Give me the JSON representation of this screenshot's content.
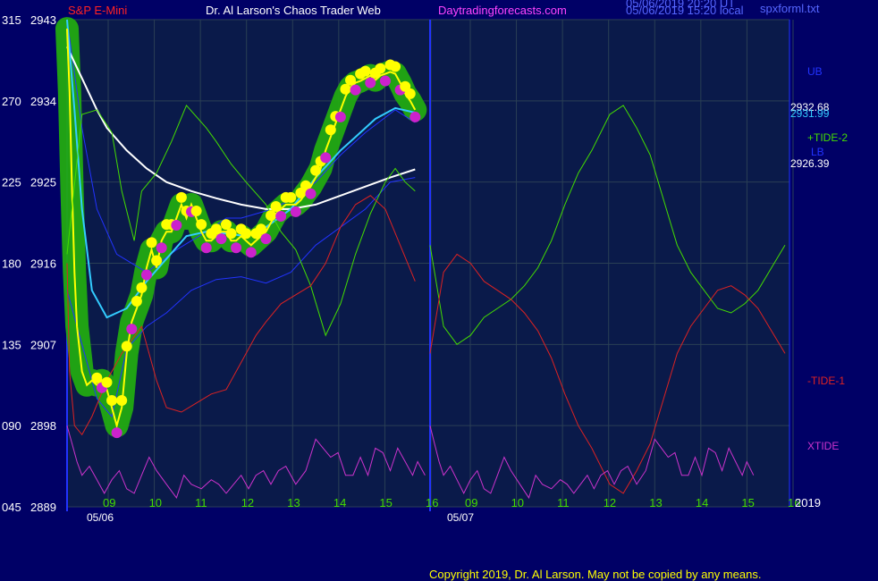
{
  "header": {
    "symbol": "S&P E-Mini",
    "author": "Dr. Al Larson's Chaos Trader Web",
    "site": "Daytradingforecasts.com",
    "stamp_line1": "05/06/2019 20:20 UT",
    "stamp_line2": "05/06/2019 15:20 local",
    "filename": "spxforml.txt"
  },
  "footer": {
    "copyright": "Copyright 2019, Dr. Al Larson. May not be copied by any means."
  },
  "chart_data": {
    "type": "line",
    "title": "S&P E-Mini",
    "ylim": [
      2889,
      2943
    ],
    "y_ticks": [
      {
        "left": "315",
        "right": "2943",
        "value": 2943
      },
      {
        "left": "270",
        "right": "2934",
        "value": 2934
      },
      {
        "left": "225",
        "right": "2925",
        "value": 2925
      },
      {
        "left": "180",
        "right": "2916",
        "value": 2916
      },
      {
        "left": "135",
        "right": "2907",
        "value": 2907
      },
      {
        "left": "090",
        "right": "2898",
        "value": 2898
      },
      {
        "left": "045",
        "right": "2889",
        "value": 2889
      }
    ],
    "x_hours": [
      "09",
      "10",
      "11",
      "12",
      "13",
      "14",
      "15",
      "16",
      "09",
      "10",
      "11",
      "12",
      "13",
      "14",
      "15",
      "16"
    ],
    "x_dates": [
      "05/06",
      "05/07"
    ],
    "year": "2019",
    "right_labels": {
      "ub": "UB",
      "v1": "2932.68",
      "v2": "2931.99",
      "tide2": "+TIDE-2",
      "lb": "LB",
      "v3": "2926.39",
      "tide1": "-TIDE-1",
      "xtide": "XTIDE"
    },
    "series": [
      {
        "name": "UB",
        "color": "#2233ff",
        "x": [
          0,
          0.3,
          0.6,
          1,
          1.6,
          2.2,
          2.8,
          3.2,
          3.5,
          4,
          4.5,
          5,
          5.5,
          6,
          6.6,
          7
        ],
        "y": [
          2943,
          2931,
          2922,
          2917,
          2915,
          2917.5,
          2919.5,
          2921,
          2921,
          2921.8,
          2923,
          2925,
          2928,
          2930.5,
          2933,
          2931.6
        ]
      },
      {
        "name": "LB",
        "color": "#2233ff",
        "x": [
          0,
          0.3,
          0.6,
          0.9,
          1.2,
          1.6,
          2,
          2.5,
          3,
          3.5,
          4,
          4.5,
          5,
          5.5,
          6,
          6.5,
          7
        ],
        "y": [
          2913,
          2907,
          2901,
          2899,
          2906.5,
          2909,
          2910.5,
          2913,
          2914.2,
          2914.5,
          2913.8,
          2915,
          2918,
          2920,
          2922,
          2925,
          2925.5
        ]
      },
      {
        "name": "slow average",
        "color": "#ffffff",
        "x": [
          0,
          0.3,
          0.6,
          0.8,
          1.2,
          1.6,
          2,
          2.5,
          3,
          3.5,
          4,
          4.5,
          5,
          5.5,
          6,
          6.5,
          7
        ],
        "y": [
          2940,
          2936.5,
          2933,
          2931,
          2928.5,
          2926.5,
          2925,
          2924,
          2923.2,
          2922.5,
          2922,
          2922,
          2922.5,
          2923.5,
          2924.5,
          2925.5,
          2926.4
        ]
      },
      {
        "name": "fast average",
        "color": "#33ccff",
        "x": [
          0,
          0.15,
          0.3,
          0.5,
          0.8,
          1.2,
          1.6,
          2,
          2.4,
          2.8,
          3.2,
          3.6,
          4,
          4.5,
          5,
          5.5,
          5.8,
          6.2,
          6.6,
          7
        ],
        "y": [
          2943,
          2933,
          2922,
          2913,
          2910,
          2911,
          2914,
          2916.5,
          2919,
          2919.5,
          2919.3,
          2919,
          2920,
          2922,
          2925.5,
          2928.5,
          2930,
          2932,
          2933.2,
          2932.7
        ]
      },
      {
        "name": "price",
        "color": "#ffff00",
        "x": [
          0,
          0.05,
          0.1,
          0.15,
          0.2,
          0.3,
          0.4,
          0.5,
          0.6,
          0.7,
          0.8,
          0.9,
          1,
          1.1,
          1.2,
          1.3,
          1.4,
          1.5,
          1.6,
          1.7,
          1.8,
          1.9,
          2,
          2.1,
          2.2,
          2.3,
          2.4,
          2.5,
          2.6,
          2.7,
          2.8,
          2.9,
          3,
          3.1,
          3.2,
          3.3,
          3.4,
          3.5,
          3.6,
          3.7,
          3.8,
          3.9,
          4,
          4.1,
          4.2,
          4.3,
          4.4,
          4.5,
          4.6,
          4.7,
          4.8,
          4.9,
          5,
          5.1,
          5.2,
          5.3,
          5.4,
          5.5,
          5.6,
          5.7,
          5.8,
          5.9,
          6,
          6.1,
          6.2,
          6.3,
          6.4,
          6.5,
          6.6,
          6.7,
          6.8,
          6.9,
          7
        ],
        "y": [
          2942,
          2935,
          2924,
          2915,
          2909,
          2904,
          2902.5,
          2903,
          2902.5,
          2903,
          2902,
          2900,
          2898,
          2900,
          2906,
          2909.5,
          2911,
          2912.5,
          2915.5,
          2917.5,
          2915.5,
          2918.5,
          2919.5,
          2919.5,
          2921,
          2922.5,
          2921,
          2922.5,
          2921,
          2919.5,
          2918.5,
          2918.5,
          2919,
          2919.5,
          2919.5,
          2918.5,
          2918.5,
          2919,
          2918.5,
          2918,
          2918.5,
          2919,
          2919.5,
          2920.5,
          2921.5,
          2922,
          2922.5,
          2922.5,
          2922.5,
          2923,
          2923.8,
          2924.5,
          2925.5,
          2926.5,
          2928.5,
          2930,
          2931.5,
          2933,
          2934.5,
          2935.5,
          2936,
          2936.2,
          2936.5,
          2936.8,
          2936.3,
          2936.8,
          2937,
          2937.2,
          2937,
          2936,
          2934.8,
          2934,
          2933
        ]
      },
      {
        "name": "+TIDE-2",
        "color": "#44dd00",
        "x": [
          0,
          0.3,
          0.6,
          0.9,
          1.1,
          1.35,
          1.5,
          1.8,
          2.1,
          2.4,
          2.8,
          3,
          3.3,
          3.6,
          4,
          4.3,
          4.6,
          4.9,
          5.2,
          5.5,
          5.8,
          6.1,
          6.4,
          6.6,
          6.8,
          7
        ],
        "y": [
          2917,
          2932.5,
          2933,
          2930.5,
          2924,
          2918.5,
          2924,
          2926,
          2929.5,
          2933.5,
          2931,
          2929.5,
          2927,
          2925,
          2922.5,
          2919.5,
          2917.5,
          2913.5,
          2908,
          2911.5,
          2917,
          2921.5,
          2925,
          2926.5,
          2925,
          2924
        ]
      },
      {
        "name": "-TIDE-1",
        "color": "#dd2222",
        "x": [
          0,
          0.05,
          0.15,
          0.3,
          0.5,
          0.8,
          1.1,
          1.5,
          1.8,
          2,
          2.3,
          2.6,
          2.9,
          3.2,
          3.5,
          3.8,
          4,
          4.3,
          4.6,
          4.9,
          5.2,
          5.5,
          5.8,
          6.1,
          6.4,
          6.7,
          7
        ],
        "y": [
          2916,
          2904,
          2898,
          2897,
          2899,
          2903,
          2906,
          2909,
          2903,
          2900,
          2899.5,
          2900.5,
          2901.5,
          2902,
          2905,
          2908,
          2909.5,
          2911.5,
          2912.5,
          2913.5,
          2916,
          2920,
          2922.5,
          2923.5,
          2922,
          2918,
          2914
        ]
      },
      {
        "name": "XTIDE",
        "color": "#cc33cc",
        "x": [
          0,
          0.1,
          0.2,
          0.3,
          0.45,
          0.6,
          0.75,
          0.9,
          1.05,
          1.2,
          1.35,
          1.5,
          1.65,
          1.8,
          2,
          2.2,
          2.35,
          2.5,
          2.7,
          2.9,
          3.05,
          3.2,
          3.35,
          3.5,
          3.65,
          3.8,
          3.95,
          4.1,
          4.25,
          4.4,
          4.6,
          4.8,
          5,
          5.15,
          5.3,
          5.45,
          5.6,
          5.75,
          5.9,
          6.05,
          6.2,
          6.35,
          6.5,
          6.65,
          6.8,
          6.95,
          7.05,
          7.2
        ],
        "y": [
          2898,
          2896,
          2894,
          2892.5,
          2893.5,
          2892,
          2890.5,
          2892,
          2893,
          2891,
          2890.5,
          2892.5,
          2894.5,
          2893,
          2891.5,
          2890,
          2892.5,
          2891.5,
          2891,
          2892,
          2891.5,
          2890.5,
          2891.5,
          2892.5,
          2891,
          2892.5,
          2893,
          2891.5,
          2893,
          2893.5,
          2891.5,
          2893,
          2896.5,
          2895.5,
          2894.5,
          2895,
          2892.5,
          2892.5,
          2894.5,
          2892.5,
          2895.5,
          2895,
          2893,
          2895.5,
          2894,
          2892.5,
          2894,
          2892.5
        ]
      }
    ],
    "right_section": {
      "tide2_up": {
        "x": [
          0,
          0.3,
          0.6,
          0.9,
          1.2,
          1.5,
          1.8,
          2.1,
          2.4,
          2.7,
          3,
          3.3,
          3.6,
          4,
          4.3,
          4.6,
          4.9,
          5.2,
          5.5,
          5.8,
          6.1,
          6.4,
          6.7,
          7,
          7.3,
          7.6,
          7.9
        ],
        "y": [
          2918,
          2909,
          2907,
          2908,
          2910,
          2911,
          2912,
          2913.5,
          2915.5,
          2918.5,
          2922.5,
          2926,
          2928.5,
          2932.5,
          2933.5,
          2931,
          2928,
          2923,
          2918,
          2915,
          2913,
          2911,
          2910.5,
          2911.5,
          2913,
          2915.5,
          2918
        ]
      }
    }
  }
}
